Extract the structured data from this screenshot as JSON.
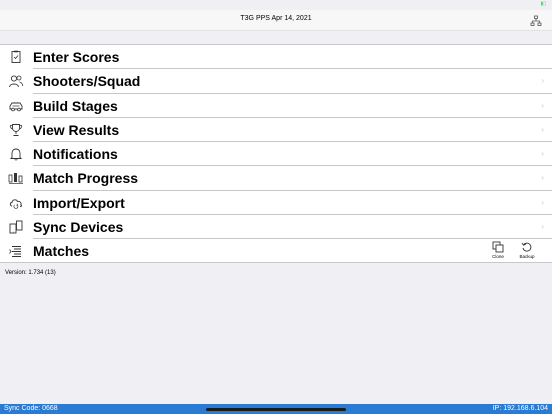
{
  "nav": {
    "title": "T3G PPS Apr 14, 2021"
  },
  "menu": {
    "items": [
      {
        "label": "Enter Scores",
        "icon": "clipboard-icon"
      },
      {
        "label": "Shooters/Squad",
        "icon": "people-icon"
      },
      {
        "label": "Build Stages",
        "icon": "car-icon"
      },
      {
        "label": "View Results",
        "icon": "trophy-icon"
      },
      {
        "label": "Notifications",
        "icon": "bell-icon"
      },
      {
        "label": "Match Progress",
        "icon": "progress-icon"
      },
      {
        "label": "Import/Export",
        "icon": "cloud-sync-icon"
      },
      {
        "label": "Sync Devices",
        "icon": "devices-icon"
      },
      {
        "label": "Matches",
        "icon": "list-icon"
      }
    ],
    "chevron": "›",
    "matches_tools": {
      "clone_label": "Clone",
      "backup_label": "Backup"
    }
  },
  "footer": {
    "version": "Version: 1.734 (13)",
    "sync_code": "Sync Code: 0668",
    "ip": "IP: 192.168.6.104"
  },
  "colors": {
    "accent": "#2a7bd4",
    "chevron": "#c7c7cc",
    "divider": "#c8c7cc"
  }
}
